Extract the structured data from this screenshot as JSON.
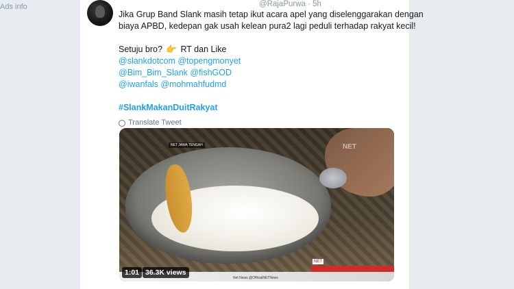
{
  "sidebar": {
    "ads_info": "Ads info"
  },
  "tweet": {
    "header": "@RajaPurwa · 5h",
    "lines": [
      "Jika Grup Band Slank masih tetap ikut acara apel yang diselenggarakan dengan",
      "biaya APBD, kedepan gak usah kelean pura2 lagi peduli terhadap rakyat kecil!"
    ],
    "question": "Setuju bro?",
    "emoji_icon": "pointing-hand-icon",
    "emoji_glyph": "👉",
    "question_suffix": "RT dan Like",
    "mention_lines": [
      "@slankdotcom @topengmonyet",
      "@Bim_Bim_Slank @fishGOD",
      "@iwanfals @mohmahfudmd"
    ],
    "hashtag": "#SlankMakanDuitRakyat",
    "translate": "Translate Tweet",
    "translate_icon": "globe-icon",
    "link_color": "#1da1f2"
  },
  "video": {
    "duration": "1:01",
    "views": "36.3K views",
    "channel_tag": "NET JAWA TENGAH",
    "watermark": "NET",
    "net_logo": "NET",
    "ticker": "Net News   @OfficialNETNews"
  }
}
